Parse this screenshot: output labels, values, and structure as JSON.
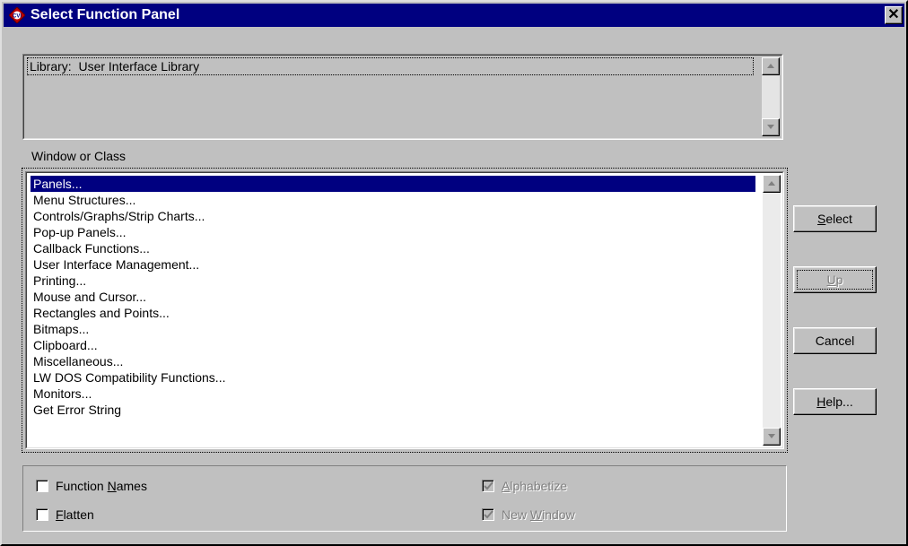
{
  "window": {
    "title": "Select Function Panel",
    "close_symbol": "✕",
    "icon": "cvi-app-icon"
  },
  "library": {
    "prefix": "Library:  ",
    "value": "User Interface Library"
  },
  "class_list": {
    "label": "Window or Class",
    "items": [
      "Panels...",
      "Menu Structures...",
      "Controls/Graphs/Strip Charts...",
      "Pop-up Panels...",
      "Callback Functions...",
      "User Interface Management...",
      "Printing...",
      "Mouse and Cursor...",
      "Rectangles and Points...",
      "Bitmaps...",
      "Clipboard...",
      "Miscellaneous...",
      "LW DOS Compatibility Functions...",
      "Monitors...",
      "Get Error String"
    ],
    "selected_index": 0
  },
  "buttons": {
    "select": {
      "mnemonic": "S",
      "rest": "elect",
      "enabled": true
    },
    "up": {
      "mnemonic": "U",
      "rest": "p",
      "enabled": false
    },
    "cancel": {
      "label": "Cancel",
      "enabled": true
    },
    "help": {
      "mnemonic": "H",
      "rest": "elp...",
      "enabled": true
    }
  },
  "options": {
    "function_names": {
      "before": "Function ",
      "mnemonic": "N",
      "after": "ames",
      "checked": false,
      "enabled": true
    },
    "flatten": {
      "before": "",
      "mnemonic": "F",
      "after": "latten",
      "checked": false,
      "enabled": true
    },
    "alphabetize": {
      "before": "",
      "mnemonic": "A",
      "after": "lphabetize",
      "checked": true,
      "enabled": false
    },
    "new_window": {
      "before": "New ",
      "mnemonic": "W",
      "after": "indow",
      "checked": true,
      "enabled": false
    }
  },
  "colors": {
    "titlebar": "#000080",
    "selection": "#000080",
    "face": "#c0c0c0",
    "icon_red": "#c00000"
  }
}
